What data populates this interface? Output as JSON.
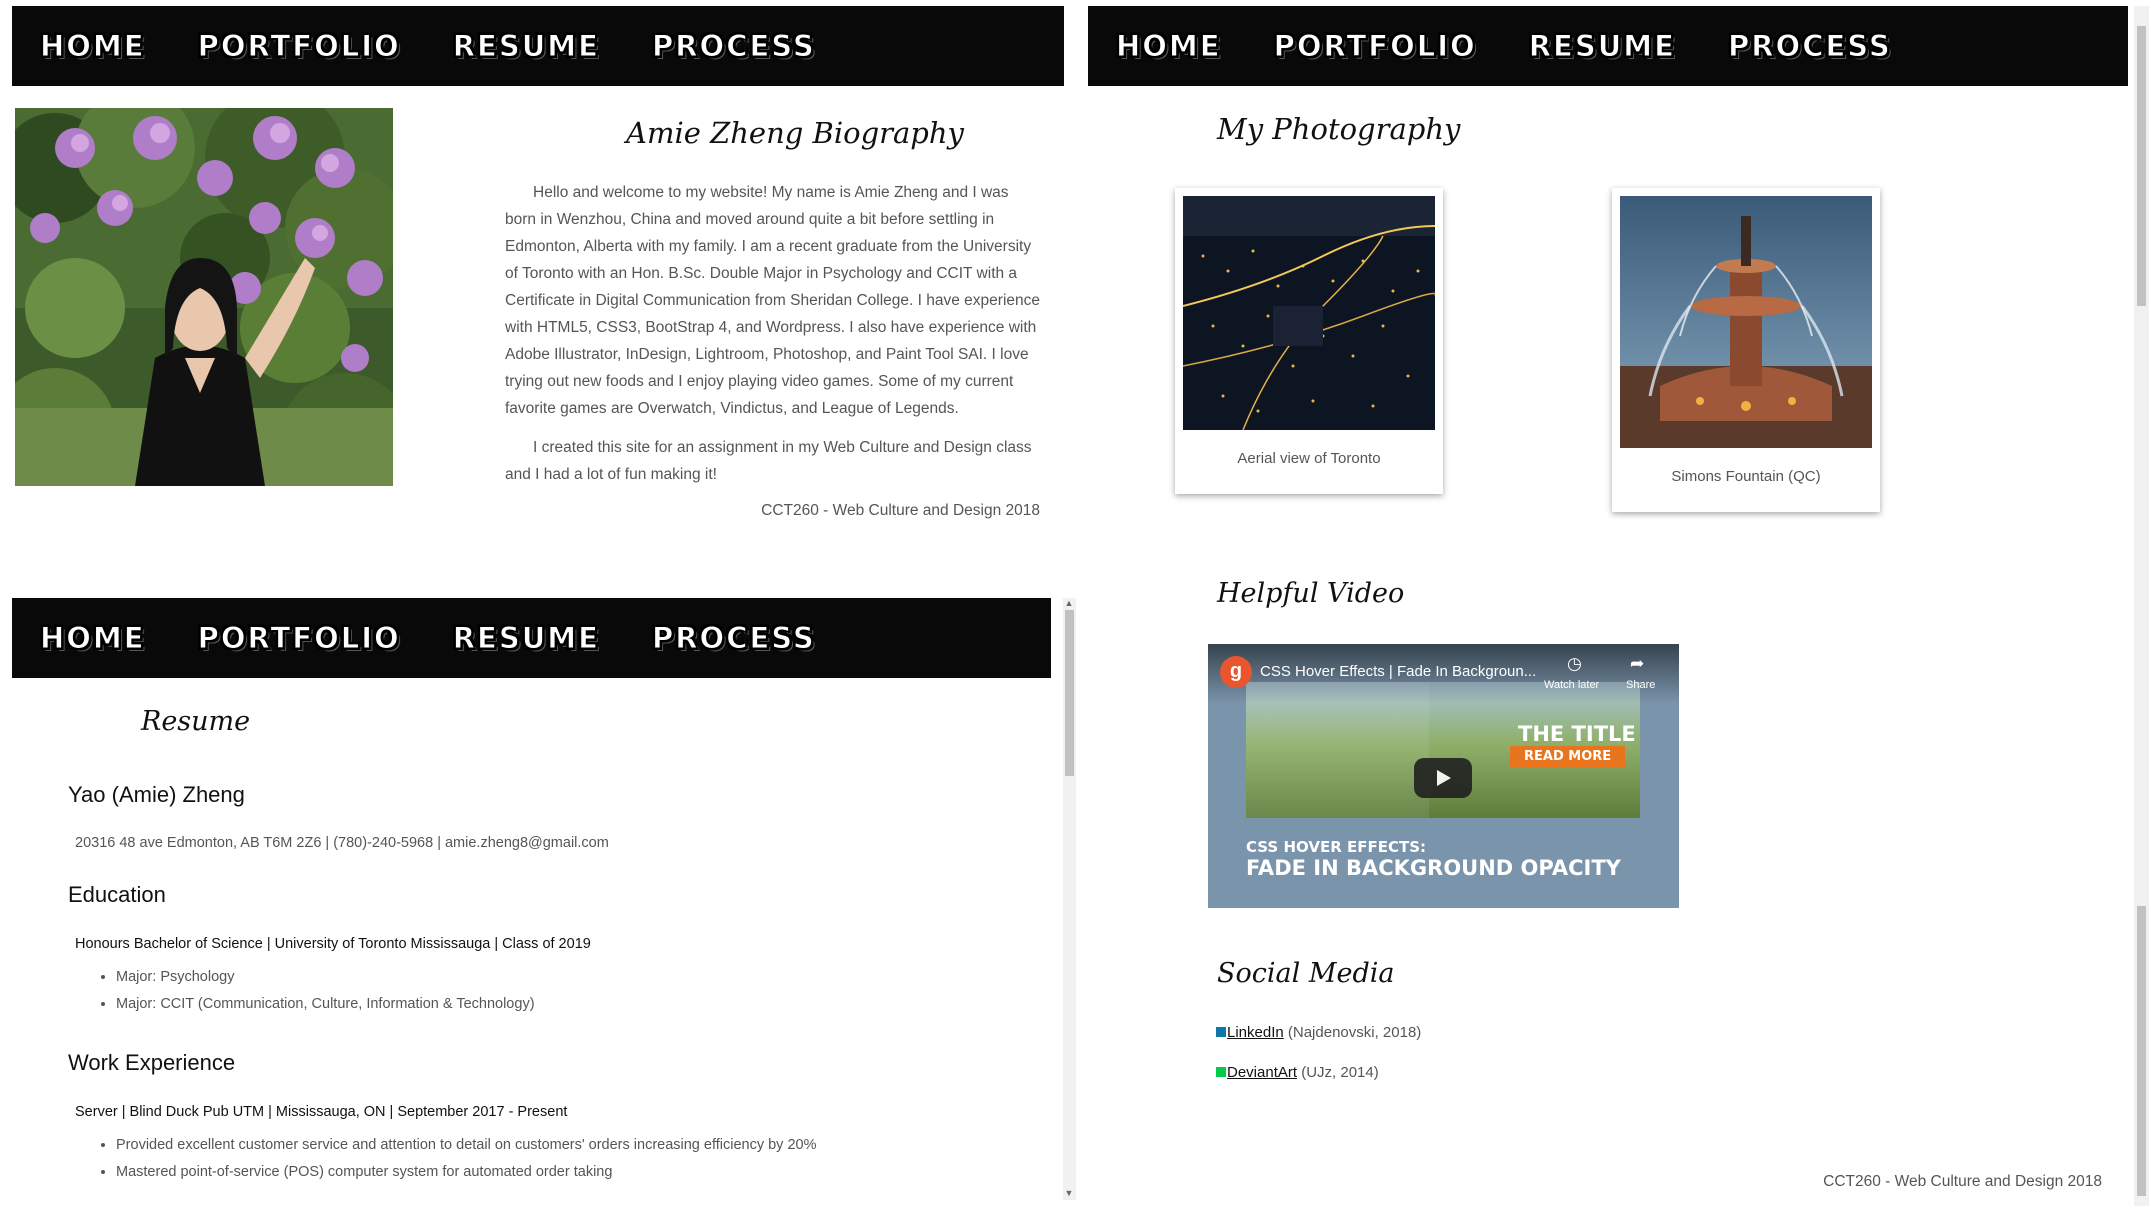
{
  "nav": {
    "items": [
      "HOME",
      "PORTFOLIO",
      "RESUME",
      "PROCESS"
    ]
  },
  "bio": {
    "title": "Amie Zheng Biography",
    "paragraph1_lines": [
      "Hello and welcome to my website! My name is Amie Zheng and I was",
      "born in Wenzhou, China and moved around quite a bit before settling in",
      "Edmonton, Alberta with my family. I am a recent graduate from the University",
      "of Toronto with an Hon. B.Sc. Double Major in Psychology and CCIT with a",
      "Certificate in Digital Communication from Sheridan College. I have experience",
      "with HTML5, CSS3, BootStrap 4, and Wordpress. I also have experience with",
      "Adobe Illustrator, InDesign, Lightroom, Photoshop, and Paint Tool SAI. I love",
      "trying out new foods and I enjoy playing video games. Some of my current",
      "favorite games are Overwatch, Vindictus, and League of Legends."
    ],
    "paragraph2_lines": [
      "I created this site for an assignment in my Web Culture and Design class",
      "and I had a lot of fun making it!"
    ],
    "footer": "CCT260 - Web Culture and Design 2018"
  },
  "portfolio": {
    "photography_title": "My Photography",
    "photos": [
      {
        "caption": "Aerial view of Toronto"
      },
      {
        "caption": "Simons Fountain (QC)"
      }
    ],
    "video_title": "Helpful Video",
    "video": {
      "title": "CSS Hover Effects | Fade In Backgroun...",
      "channel_initial": "g",
      "watch_later": "Watch later",
      "share": "Share",
      "thumb_title": "THE TITLE",
      "thumb_read_more": "READ MORE",
      "thumb_line1": "CSS HOVER EFFECTS:",
      "thumb_line2": "FADE IN BACKGROUND OPACITY"
    },
    "social_title": "Social Media",
    "social": [
      {
        "link": "LinkedIn",
        "note": "(Najdenovski, 2018)"
      },
      {
        "link": "DeviantArt",
        "note": "(UJz, 2014)"
      }
    ],
    "footer": "CCT260 - Web Culture and Design 2018"
  },
  "resume": {
    "title": "Resume",
    "name": "Yao (Amie) Zheng",
    "contact": "20316 48 ave Edmonton, AB T6M 2Z6 | (780)-240-5968 | amie.zheng8@gmail.com",
    "education_heading": "Education",
    "education_entry": "Honours Bachelor of Science | University of Toronto Mississauga | Class of 2019",
    "education_bullets": [
      "Major: Psychology",
      "Major: CCIT (Communication, Culture, Information & Technology)"
    ],
    "work_heading": "Work Experience",
    "work_entry": "Server | Blind Duck Pub UTM | Mississauga, ON | September 2017 - Present",
    "work_bullets": [
      "Provided excellent customer service and attention to detail on customers' orders increasing efficiency by 20%",
      "Mastered point-of-service (POS) computer system for automated order taking"
    ]
  },
  "colors": {
    "navbar": "#080908",
    "youtube_red": "#ff0000",
    "read_more": "#e8741e"
  }
}
